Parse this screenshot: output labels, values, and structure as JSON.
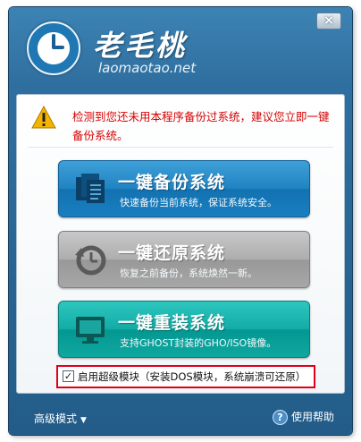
{
  "header": {
    "logo_name": "老毛桃",
    "logo_url": "laomaotao.net",
    "close_glyph": "×"
  },
  "warning": {
    "text": "检测到您还未用本程序备份过系统，建议您立即一键备份系统。"
  },
  "buttons": {
    "backup": {
      "title": "一键备份系统",
      "subtitle": "快速备份当前系统，保证系统安全。"
    },
    "restore": {
      "title": "一键还原系统",
      "subtitle": "恢复之前备份，系统焕然一新。"
    },
    "reinstall": {
      "title": "一键重装系统",
      "subtitle": "支持GHOST封装的GHO/ISO镜像。"
    }
  },
  "option": {
    "checked": true,
    "check_glyph": "✓",
    "label": "启用超级模块（安装DOS模块，系统崩溃可还原）"
  },
  "footer": {
    "advanced_label": "高级模式",
    "advanced_caret": "▼",
    "help_glyph": "?",
    "help_label": "使用帮助"
  },
  "colors": {
    "warning_text": "#d40000",
    "button_blue": "#1f83c2",
    "button_gray": "#a7a7a7",
    "button_teal": "#12aba5",
    "highlight_border": "#e0001a"
  },
  "icons": [
    "close-icon",
    "clock-logo-icon",
    "warning-icon",
    "documents-icon",
    "restore-clock-icon",
    "monitor-icon",
    "checkbox-icon",
    "help-icon"
  ]
}
